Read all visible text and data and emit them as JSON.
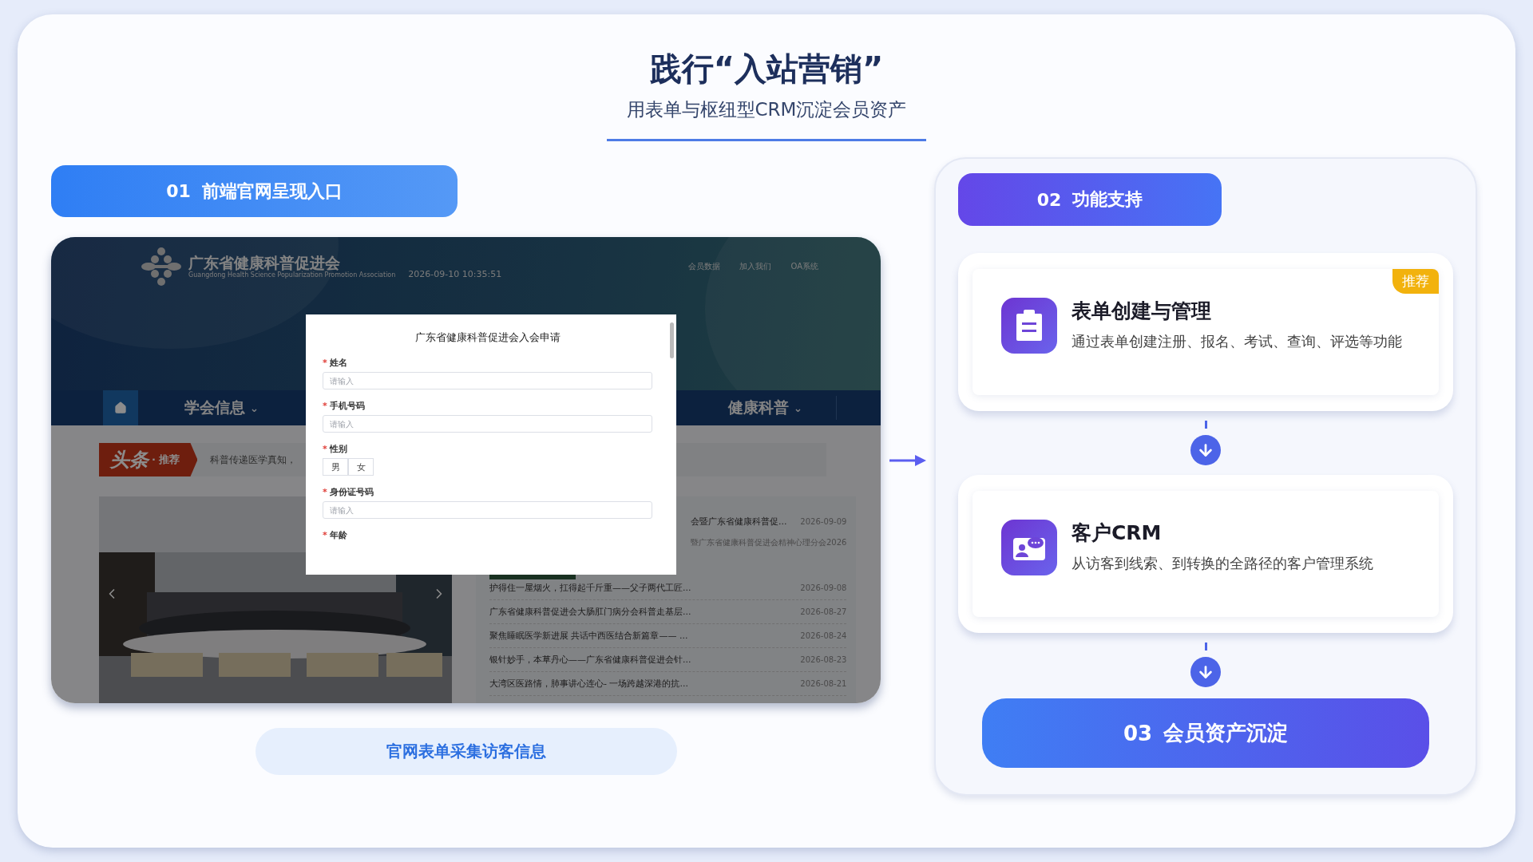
{
  "title": "践行“入站营销”",
  "subtitle": "用表单与枢纽型CRM沉淀会员资产",
  "left": {
    "step": {
      "number": "01",
      "label": "前端官网呈现入口"
    },
    "website": {
      "org_name": "广东省健康科普促进会",
      "org_name_en": "Guangdong Health Science Popularization Promotion Association",
      "datetime": "2026-09-10 10:35:51",
      "top_links": [
        "会员数据",
        "加入我们",
        "OA系统"
      ],
      "nav": [
        {
          "label": "学会信息",
          "caret": "⌄"
        },
        {
          "label": "健康科普",
          "caret": "⌄"
        }
      ],
      "headline": {
        "tag": "头条",
        "tag_sub": "· 推荐",
        "text": "科普传递医学真知，"
      },
      "featured": {
        "title": "会暨广东省健康科普促...",
        "date": "2026-09-09",
        "summary": "暨广东省健康科普促进会精神心理分会2026"
      },
      "news": [
        {
          "title": "护得住一屋烟火，扛得起千斤重——父子两代工匠...",
          "date": "2026-09-08"
        },
        {
          "title": "广东省健康科普促进会大肠肛门病分会科普走基层...",
          "date": "2026-08-27"
        },
        {
          "title": "聚焦睡眠医学新进展 共话中西医结合新篇章—— ...",
          "date": "2026-08-24"
        },
        {
          "title": "银针妙手，本草丹心——广东省健康科普促进会针...",
          "date": "2026-08-23"
        },
        {
          "title": "大湾区医路情，肺事讲心连心- 一场跨越深港的抗...",
          "date": "2026-08-21"
        }
      ],
      "form": {
        "title": "广东省健康科普促进会入会申请",
        "fields": [
          {
            "kind": "text",
            "mark": "*",
            "label": "姓名",
            "placeholder": "请输入"
          },
          {
            "kind": "text",
            "mark": "*",
            "label": "手机号码",
            "placeholder": "请输入"
          },
          {
            "kind": "choice",
            "mark": "*",
            "label": "性别",
            "options": [
              {
                "label": "男",
                "selected": false
              },
              {
                "label": "女",
                "selected": false
              }
            ]
          },
          {
            "kind": "text",
            "mark": "*",
            "label": "身份证号码",
            "placeholder": "请输入"
          },
          {
            "kind": "text",
            "mark": "*",
            "label": "年龄"
          }
        ]
      }
    },
    "caption": "官网表单采集访客信息"
  },
  "right": {
    "step": {
      "number": "02",
      "label": "功能支持"
    },
    "features": [
      {
        "kind": "form",
        "title": "表单创建与管理",
        "description": "通过表单创建注册、报名、考试、查询、评选等功能",
        "badge": "推荐"
      },
      {
        "kind": "crm",
        "title": "客户CRM",
        "description": "从访客到线索、到转换的全路径的客户管理系统"
      }
    ],
    "result": {
      "number": "03",
      "label": "会员资产沉淀"
    }
  }
}
